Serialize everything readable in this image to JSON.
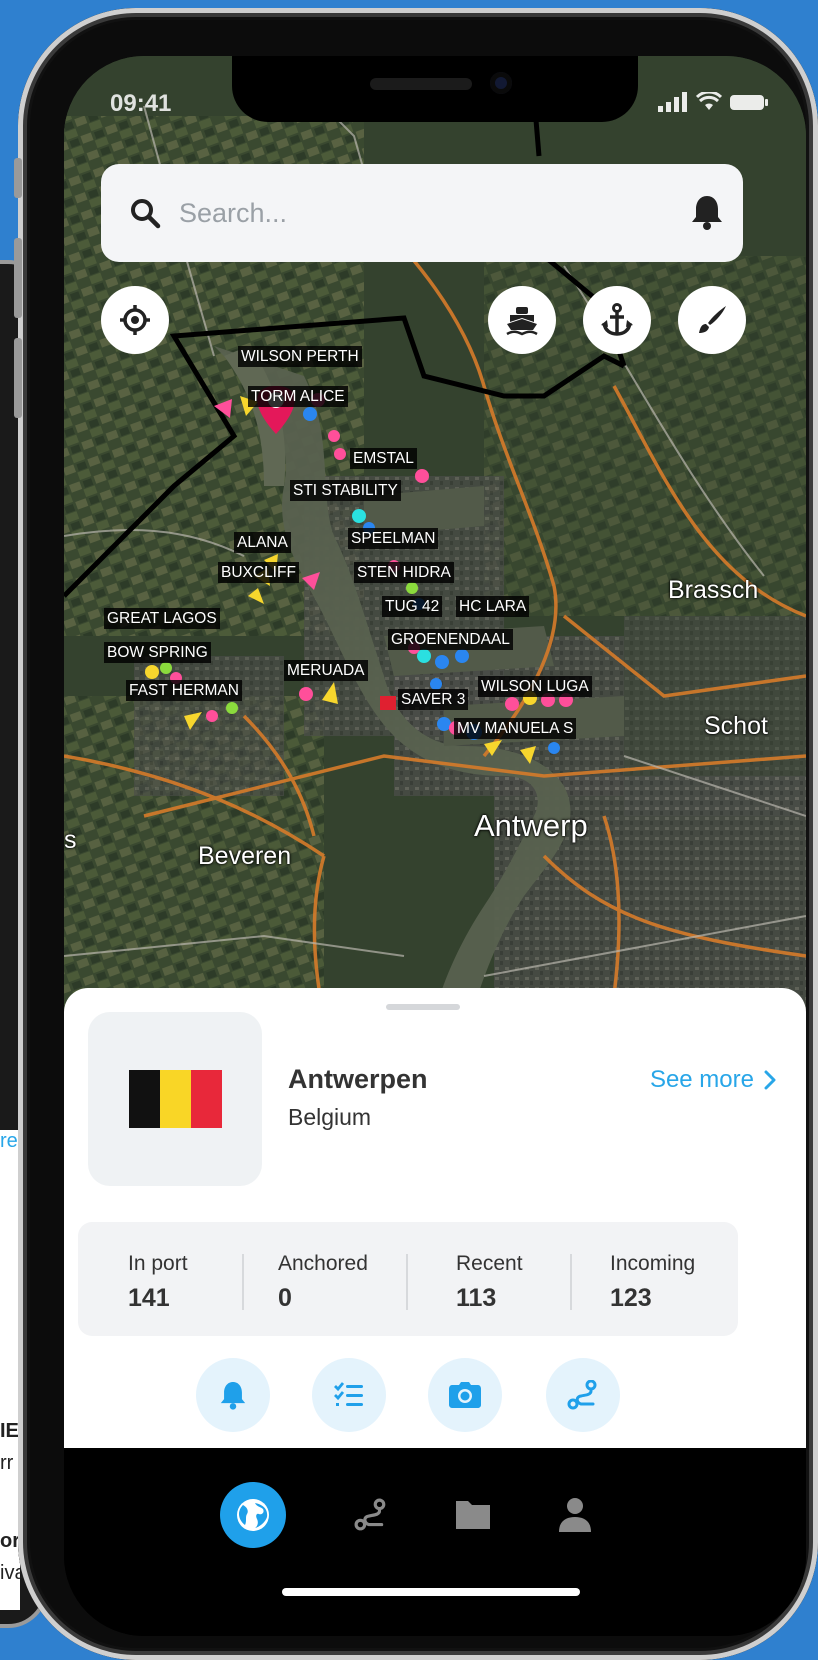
{
  "status_bar": {
    "time": "09:41"
  },
  "search": {
    "placeholder": "Search..."
  },
  "map": {
    "places": [
      "Brassch",
      "Schot",
      "Antwerp",
      "Beveren",
      "s"
    ],
    "vessels": [
      "WILSON PERTH",
      "TORM ALICE",
      "EMSTAL",
      "STI STABILITY",
      "SPEELMAN",
      "ALANA",
      "BUXCLIFF",
      "STEN HIDRA",
      "GREAT LAGOS",
      "TUG 42",
      "HC LARA",
      "GROENENDAAL",
      "BOW SPRING",
      "MERUADA",
      "WILSON LUGA",
      "FAST HERMAN",
      "SAVER 3",
      "MV MANUELA S"
    ]
  },
  "port": {
    "name": "Antwerpen",
    "country": "Belgium",
    "see_more": "See more",
    "flag_colors": [
      "#111111",
      "#f9d626",
      "#e8283a"
    ]
  },
  "stats": [
    {
      "label": "In port",
      "value": "141"
    },
    {
      "label": "Anchored",
      "value": "0"
    },
    {
      "label": "Recent",
      "value": "113"
    },
    {
      "label": "Incoming",
      "value": "123"
    }
  ],
  "quick_actions": [
    "bell-icon",
    "checklist-icon",
    "camera-icon",
    "route-icon"
  ],
  "tabbar": [
    "globe-icon",
    "route-icon",
    "folder-icon",
    "person-icon"
  ],
  "background_phone": {
    "texts": [
      "re",
      "IE",
      "rr",
      "or",
      "iva"
    ]
  },
  "colors": {
    "accent": "#1fa0ea",
    "link": "#28a6e8",
    "background": "#2f80cf",
    "pin": "#e4185a"
  }
}
